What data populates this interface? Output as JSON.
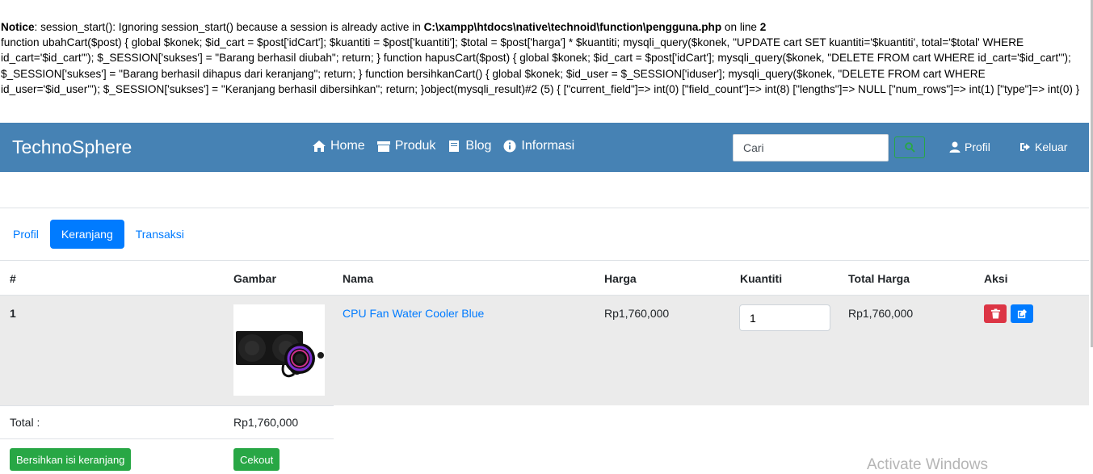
{
  "notice": {
    "label": "Notice",
    "message": ": session_start(): Ignoring session_start() because a session is already active in ",
    "path": "C:\\xampp\\htdocs\\native\\technoid\\function\\pengguna.php",
    "online": " on line ",
    "line": "2",
    "code": "function ubahCart($post) { global $konek; $id_cart = $post['idCart']; $kuantiti = $post['kuantiti']; $total = $post['harga'] * $kuantiti; mysqli_query($konek, \"UPDATE cart SET kuantiti='$kuantiti', total='$total' WHERE id_cart='$id_cart'\"); $_SESSION['sukses'] = \"Barang berhasil diubah\"; return; } function hapusCart($post) { global $konek; $id_cart = $post['idCart']; mysqli_query($konek, \"DELETE FROM cart WHERE id_cart='$id_cart'\"); $_SESSION['sukses'] = \"Barang berhasil dihapus dari keranjang\"; return; } function bersihkanCart() { global $konek; $id_user = $_SESSION['iduser']; mysqli_query($konek, \"DELETE FROM cart WHERE id_user='$id_user'\"); $_SESSION['sukses'] = \"Keranjang berhasil dibersihkan\"; return; }object(mysqli_result)#2 (5) { [\"current_field\"]=> int(0) [\"field_count\"]=> int(8) [\"lengths\"]=> NULL [\"num_rows\"]=> int(1) [\"type\"]=> int(0) }"
  },
  "navbar": {
    "brand": "TechnoSphere",
    "links": [
      {
        "label": "Home",
        "icon": "home-icon"
      },
      {
        "label": "Produk",
        "icon": "store-icon"
      },
      {
        "label": "Blog",
        "icon": "book-icon"
      },
      {
        "label": "Informasi",
        "icon": "info-icon"
      }
    ],
    "search_placeholder": "Cari",
    "profil": "Profil",
    "keluar": "Keluar"
  },
  "tabs": [
    {
      "label": "Profil",
      "active": false
    },
    {
      "label": "Keranjang",
      "active": true
    },
    {
      "label": "Transaksi",
      "active": false
    }
  ],
  "table": {
    "headers": [
      "#",
      "Gambar",
      "Nama",
      "Harga",
      "Kuantiti",
      "Total Harga",
      "Aksi"
    ],
    "rows": [
      {
        "no": "1",
        "name": "CPU Fan Water Cooler Blue",
        "price": "Rp1,760,000",
        "qty": "1",
        "total": "Rp1,760,000"
      }
    ],
    "total_label": "Total :",
    "total_value": "Rp1,760,000"
  },
  "buttons": {
    "clear": "Bersihkan isi keranjang",
    "checkout": "Cekout"
  },
  "watermark": "Activate Windows",
  "colors": {
    "navbar": "#4682b4",
    "primary": "#007bff",
    "success": "#28a745",
    "danger": "#dc3545"
  }
}
